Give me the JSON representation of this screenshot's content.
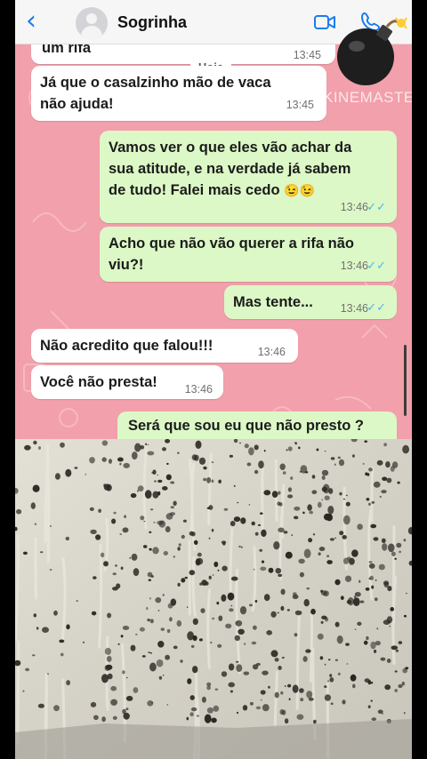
{
  "header": {
    "back_icon": "chevron-left-icon",
    "contact_name": "Sogrinha",
    "video_icon": "video-camera-icon",
    "phone_icon": "phone-icon"
  },
  "colors": {
    "chat_bg": "#f2a0ab",
    "incoming_bubble": "#ffffff",
    "outgoing_bubble": "#dcf8c6",
    "read_ticks": "#4fb6ec",
    "accent": "#1a7cf0"
  },
  "watermark": "KINEMASTER",
  "date_chip": "Hoje",
  "messages": [
    {
      "dir": "in",
      "text": "um rifa",
      "time": "13:45"
    },
    {
      "dir": "in",
      "lines": [
        "Já que o casalzinho mão de vaca",
        "não ajuda!"
      ],
      "time": "13:45"
    },
    {
      "dir": "out",
      "lines": [
        "Vamos ver o que eles vão achar da",
        "sua atitude, e na verdade já sabem",
        "de tudo! Falei mais cedo"
      ],
      "emoji": "😉😉",
      "time": "13:46",
      "ticks": "✓✓"
    },
    {
      "dir": "out",
      "lines": [
        "Acho que não vão querer a rifa não",
        "viu?!"
      ],
      "time": "13:46",
      "ticks": "✓✓"
    },
    {
      "dir": "out",
      "text": "Mas tente...",
      "time": "13:46",
      "ticks": "✓✓"
    },
    {
      "dir": "in",
      "text": "Não acredito que falou!!!",
      "time": "13:46"
    },
    {
      "dir": "in",
      "text": "Você não presta!",
      "time": "13:46"
    },
    {
      "dir": "out",
      "text": "Será que sou eu que não presto ?"
    }
  ],
  "sticker": "bomb-icon"
}
